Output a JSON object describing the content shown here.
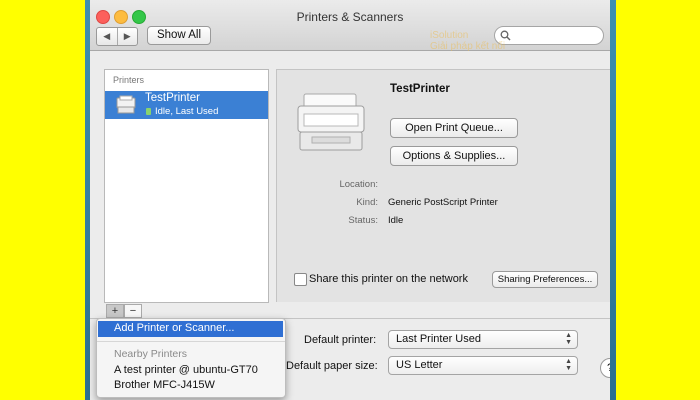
{
  "window": {
    "title": "Printers & Scanners"
  },
  "toolbar": {
    "back_label": "◀",
    "forward_label": "▶",
    "show_all_label": "Show All",
    "search_placeholder": ""
  },
  "sidebar": {
    "header": "Printers",
    "items": [
      {
        "name": "TestPrinter",
        "status": "Idle, Last Used"
      }
    ],
    "add_label": "+",
    "remove_label": "−"
  },
  "detail": {
    "printer_name": "TestPrinter",
    "open_queue_label": "Open Print Queue...",
    "options_label": "Options & Supplies...",
    "fields": [
      {
        "label": "Location:",
        "value": ""
      },
      {
        "label": "Kind:",
        "value": "Generic PostScript Printer"
      },
      {
        "label": "Status:",
        "value": "Idle"
      }
    ],
    "share_label": "Share this printer on the network",
    "share_checked": false,
    "sharing_prefs_label": "Sharing Preferences..."
  },
  "bottom": {
    "default_printer_label": "Default printer:",
    "default_printer_value": "Last Printer Used",
    "paper_size_label": "Default paper size:",
    "paper_size_value": "US Letter",
    "help_label": "?"
  },
  "add_menu": {
    "add_item": "Add Printer or Scanner...",
    "nearby_header": "Nearby Printers",
    "nearby": [
      "A test printer @ ubuntu-GT70",
      "Brother MFC-J415W"
    ]
  },
  "watermark": {
    "brand": "iSolution",
    "tagline": "Giải pháp kết nối"
  },
  "colors": {
    "frame": "#ffff00",
    "selection": "#3b80d4",
    "menu_highlight": "#2f6fd3"
  }
}
